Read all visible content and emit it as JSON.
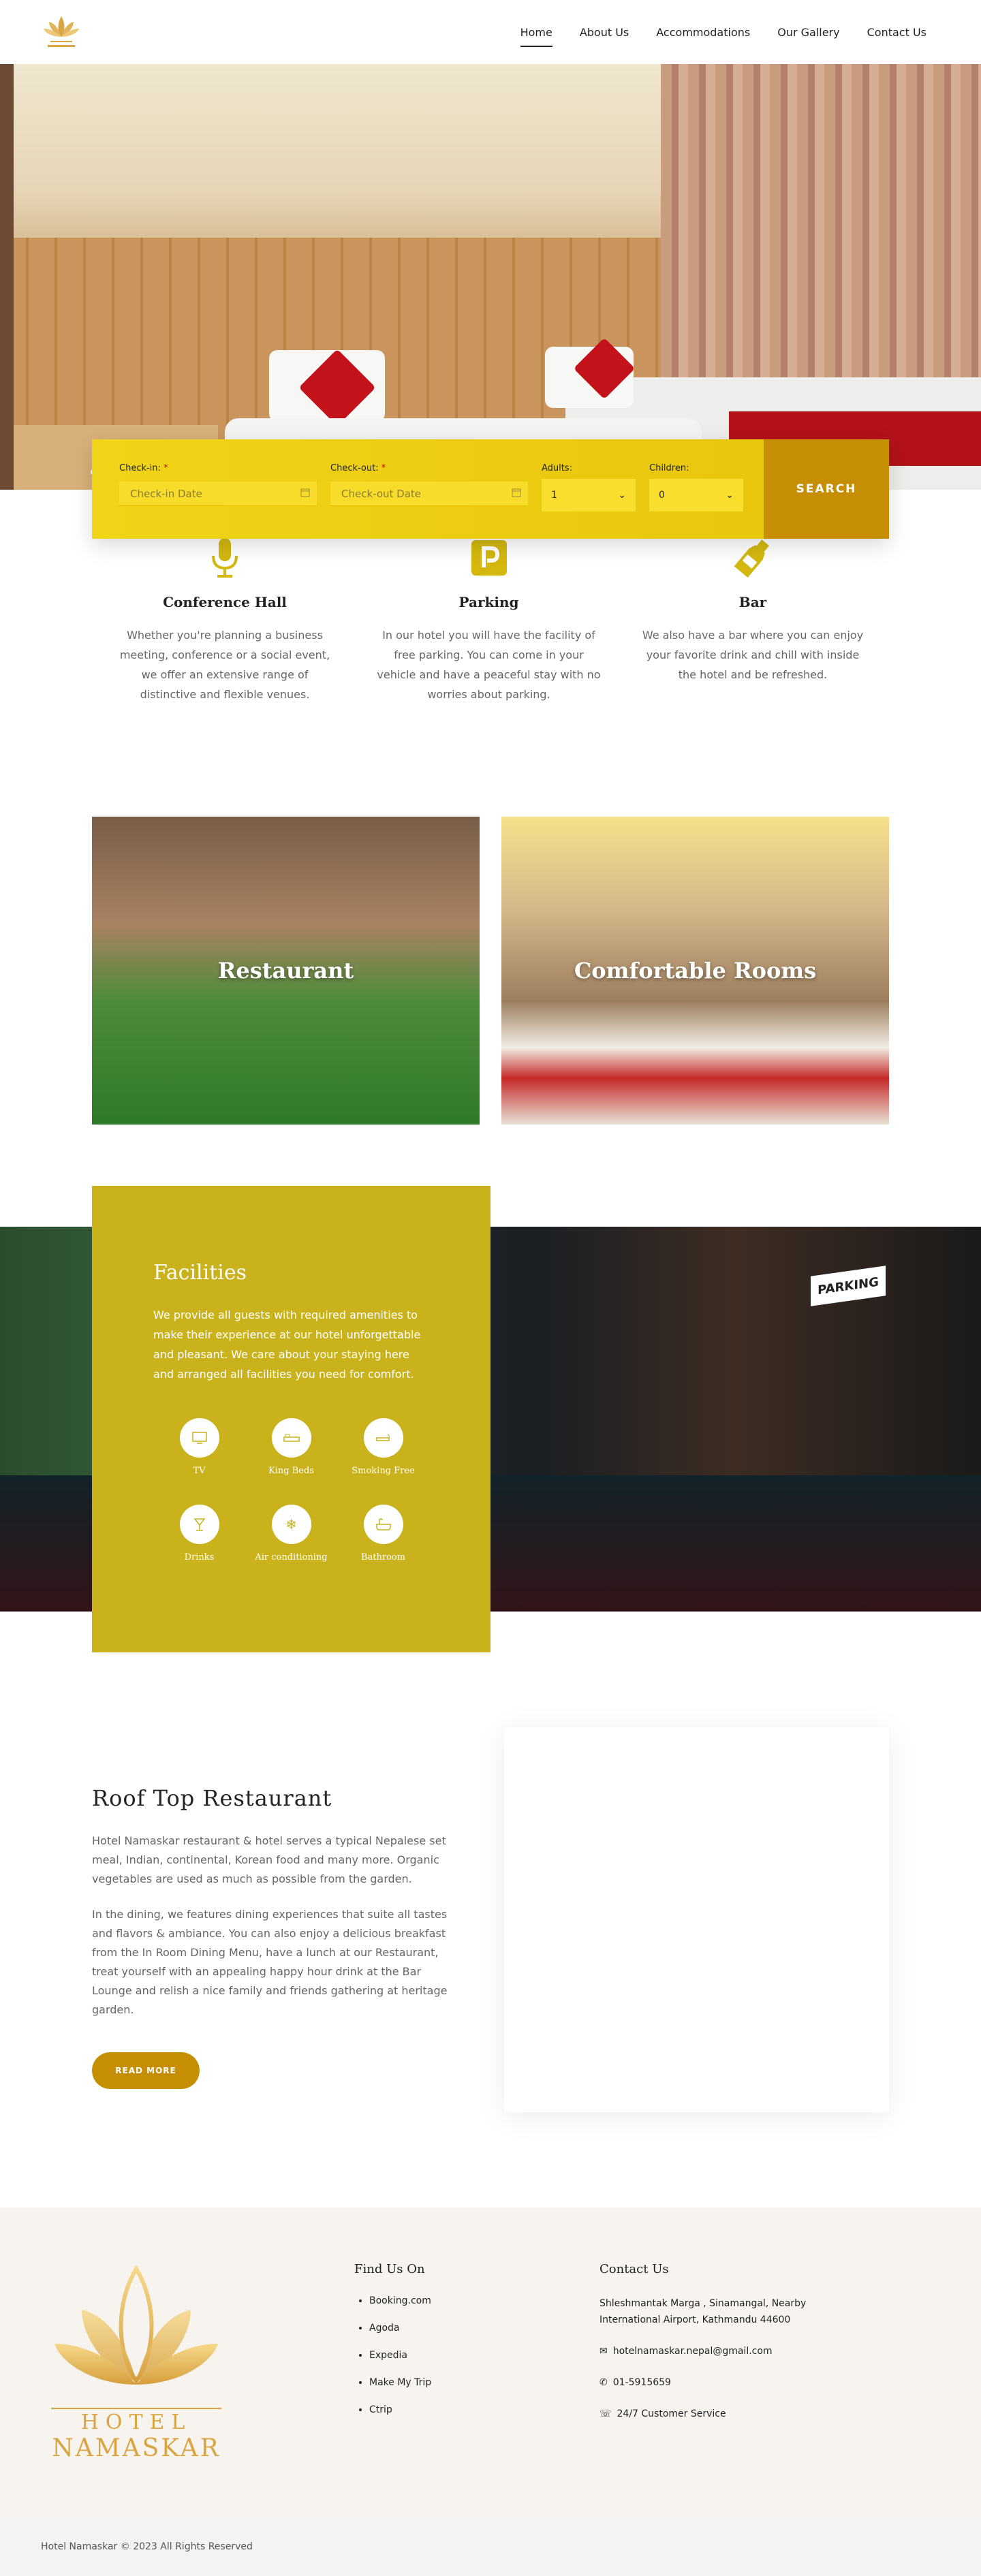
{
  "brand": {
    "name": "HOTEL",
    "name2": "NAMASKAR",
    "logo_icon": "lotus-icon"
  },
  "nav": {
    "items": [
      "Home",
      "About Us",
      "Accommodations",
      "Our Gallery",
      "Contact Us"
    ],
    "active": "Home"
  },
  "booking": {
    "checkin_label": "Check-in:",
    "checkin_placeholder": "Check-in Date",
    "checkout_label": "Check-out:",
    "checkout_placeholder": "Check-out Date",
    "adults_label": "Adults:",
    "adults_value": "1",
    "children_label": "Children:",
    "children_value": "0",
    "required_mark": "*",
    "search_label": "SEARCH"
  },
  "features": [
    {
      "icon": "microphone-icon",
      "title": "Conference Hall",
      "text": "Whether you're planning a business meeting, conference or a social event, we offer an extensive range of distinctive and flexible venues."
    },
    {
      "icon": "parking-icon",
      "title": "Parking",
      "text": "In our hotel you will have the facility of free parking. You can come in your vehicle and have a peaceful stay with no worries about parking."
    },
    {
      "icon": "bottle-icon",
      "title": "Bar",
      "text": "We also have a bar where you can enjoy your favorite drink and chill with inside the hotel and be refreshed."
    }
  ],
  "cards": [
    {
      "title": "Restaurant"
    },
    {
      "title": "Comfortable Rooms"
    }
  ],
  "facilities": {
    "title": "Facilities",
    "text": "We provide all guests with required amenities to make their experience at our hotel unforgettable and pleasant. We care about your staying here and arranged all facilities you need for comfort.",
    "amenities": [
      {
        "icon": "tv-icon",
        "label": "TV"
      },
      {
        "icon": "bed-icon",
        "label": "King Beds"
      },
      {
        "icon": "no-smoking-icon",
        "label": "Smoking Free"
      },
      {
        "icon": "drinks-icon",
        "label": "Drinks"
      },
      {
        "icon": "snowflake-icon",
        "label": "Air conditioning"
      },
      {
        "icon": "bathtub-icon",
        "label": "Bathroom"
      }
    ],
    "photo_sign": "PARKING"
  },
  "restaurant": {
    "title": "Roof Top Restaurant",
    "p1": "Hotel Namaskar restaurant & hotel serves a typical Nepalese set meal, Indian, continental, Korean food and many more. Organic vegetables are used as much as possible from the garden.",
    "p2": "In the dining, we features dining experiences that suite all tastes and flavors & ambiance. You can also enjoy a delicious breakfast from the In Room Dining Menu, have a lunch at our Restaurant, treat yourself with an appealing happy hour drink at the Bar Lounge and relish a nice family and friends gathering at heritage garden.",
    "button": "READ MORE"
  },
  "footer": {
    "find_title": "Find Us On",
    "find_links": [
      "Booking.com",
      "Agoda",
      "Expedia",
      "Make My Trip",
      "Ctrip"
    ],
    "contact_title": "Contact Us",
    "address": "Shleshmantak Marga , Sinamangal, Nearby International Airport, Kathmandu 44600",
    "email": "hotelnamaskar.nepal@gmail.com",
    "phone": "01-5915659",
    "service": "24/7 Customer Service",
    "copyright": "Hotel Namaskar © 2023 All Rights Reserved"
  },
  "colors": {
    "gold": "#c68e02",
    "yellow": "#f0d419",
    "olive": "#c9b21b"
  }
}
